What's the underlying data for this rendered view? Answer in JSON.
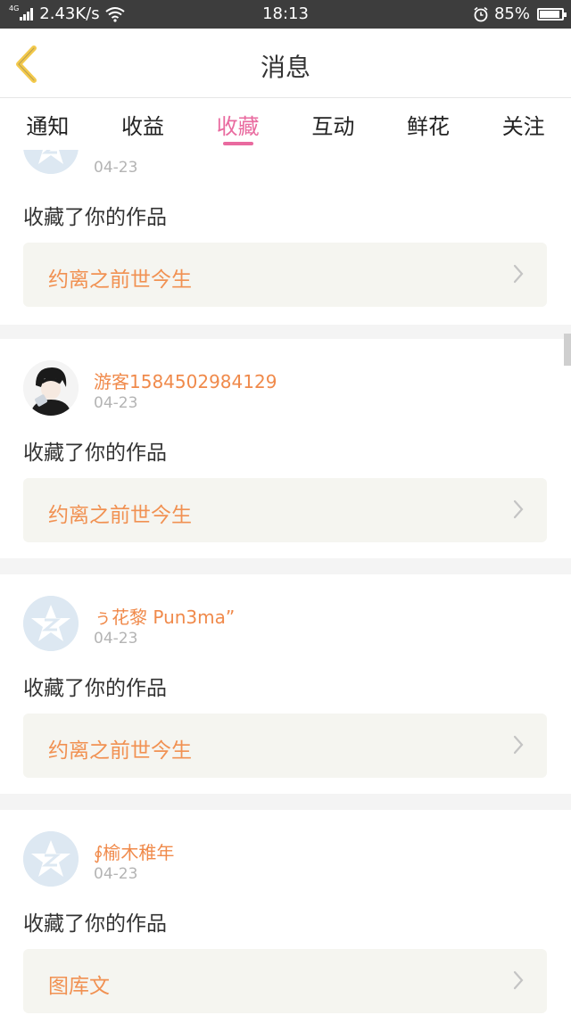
{
  "statusbar": {
    "network": "4G",
    "speed": "2.43K/s",
    "time": "18:13",
    "battery": "85%",
    "battery_level": 0.85
  },
  "header": {
    "title": "消息"
  },
  "tabs": [
    {
      "label": "通知"
    },
    {
      "label": "收益"
    },
    {
      "label": "收藏",
      "active": true
    },
    {
      "label": "互动"
    },
    {
      "label": "鲜花"
    },
    {
      "label": "关注"
    }
  ],
  "cards": [
    {
      "username": "",
      "date": "04-23",
      "action": "收藏了你的作品",
      "work": "约离之前世今生",
      "avatar": "default-avatar"
    },
    {
      "username": "游客1584502984129",
      "date": "04-23",
      "action": "收藏了你的作品",
      "work": "约离之前世今生",
      "avatar": "photo-avatar"
    },
    {
      "username": "ぅ花黎 Pun3ma”",
      "date": "04-23",
      "action": "收藏了你的作品",
      "work": "约离之前世今生",
      "avatar": "default-avatar"
    },
    {
      "username": "∮榆木稚年",
      "date": "04-23",
      "action": "收藏了你的作品",
      "work": "图库文",
      "avatar": "default-avatar"
    }
  ],
  "colors": {
    "accent": "#e96a9f",
    "username": "#f08a4b",
    "work_title": "#f19152",
    "back_arrow": "#f3c94b"
  }
}
